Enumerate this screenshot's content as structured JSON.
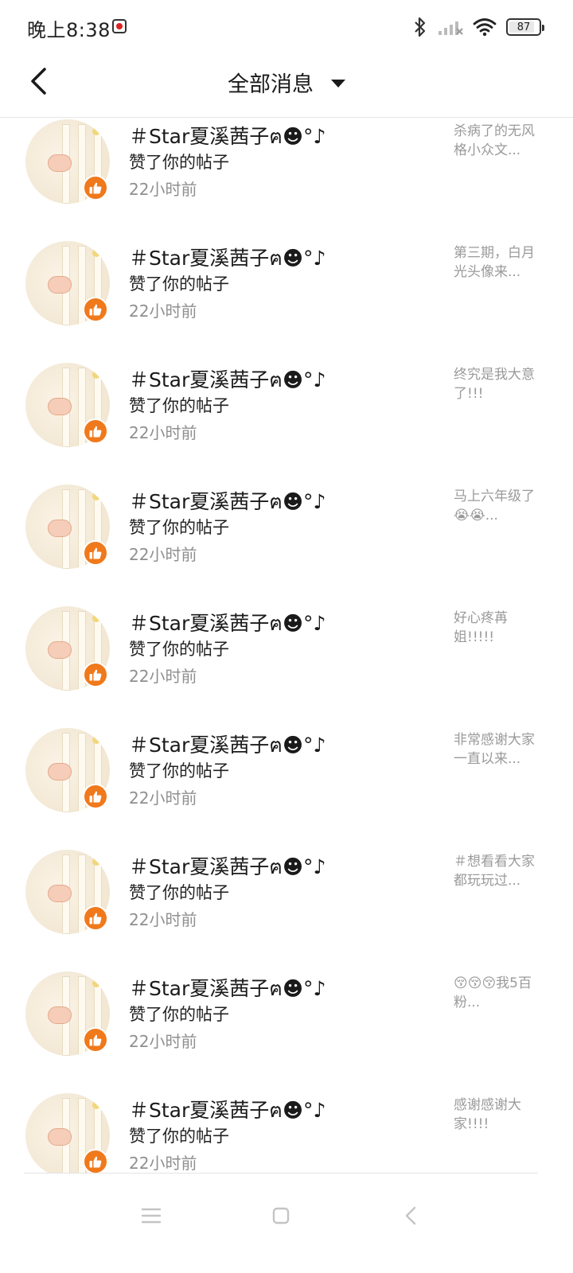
{
  "status_bar": {
    "time": "晚上8:38",
    "battery": "87",
    "battery_fraction": 0.87,
    "icons": [
      "notification-icon",
      "bluetooth-icon",
      "signal-icon",
      "wifi-icon",
      "battery-icon"
    ]
  },
  "header": {
    "title": "全部消息",
    "back_icon": "chevron-left-icon",
    "dropdown_icon": "caret-down-icon"
  },
  "colors": {
    "like_badge": "#f0791b",
    "preview_text": "#9a9a9a",
    "time_text": "#8f8f8f"
  },
  "messages": [
    {
      "name": "＃Star夏溪茜子ฅ☻°♪",
      "action": "赞了你的帖子",
      "time": "22小时前",
      "preview": "杀病了的无风格小众文..."
    },
    {
      "name": "＃Star夏溪茜子ฅ☻°♪",
      "action": "赞了你的帖子",
      "time": "22小时前",
      "preview": "第三期，白月光头像来..."
    },
    {
      "name": "＃Star夏溪茜子ฅ☻°♪",
      "action": "赞了你的帖子",
      "time": "22小时前",
      "preview": "终究是我大意了!!!"
    },
    {
      "name": "＃Star夏溪茜子ฅ☻°♪",
      "action": "赞了你的帖子",
      "time": "22小时前",
      "preview": "马上六年级了😭😭..."
    },
    {
      "name": "＃Star夏溪茜子ฅ☻°♪",
      "action": "赞了你的帖子",
      "time": "22小时前",
      "preview": "好心疼苒姐!!!!!"
    },
    {
      "name": "＃Star夏溪茜子ฅ☻°♪",
      "action": "赞了你的帖子",
      "time": "22小时前",
      "preview": "非常感谢大家一直以来..."
    },
    {
      "name": "＃Star夏溪茜子ฅ☻°♪",
      "action": "赞了你的帖子",
      "time": "22小时前",
      "preview": "＃想看看大家都玩玩过..."
    },
    {
      "name": "＃Star夏溪茜子ฅ☻°♪",
      "action": "赞了你的帖子",
      "time": "22小时前",
      "preview": "😚😚😚我5百粉..."
    },
    {
      "name": "＃Star夏溪茜子ฅ☻°♪",
      "action": "赞了你的帖子",
      "time": "22小时前",
      "preview": "感谢感谢大家!!!!"
    }
  ],
  "nav": {
    "buttons": [
      "menu-icon",
      "home-square-icon",
      "back-triangle-icon"
    ]
  }
}
